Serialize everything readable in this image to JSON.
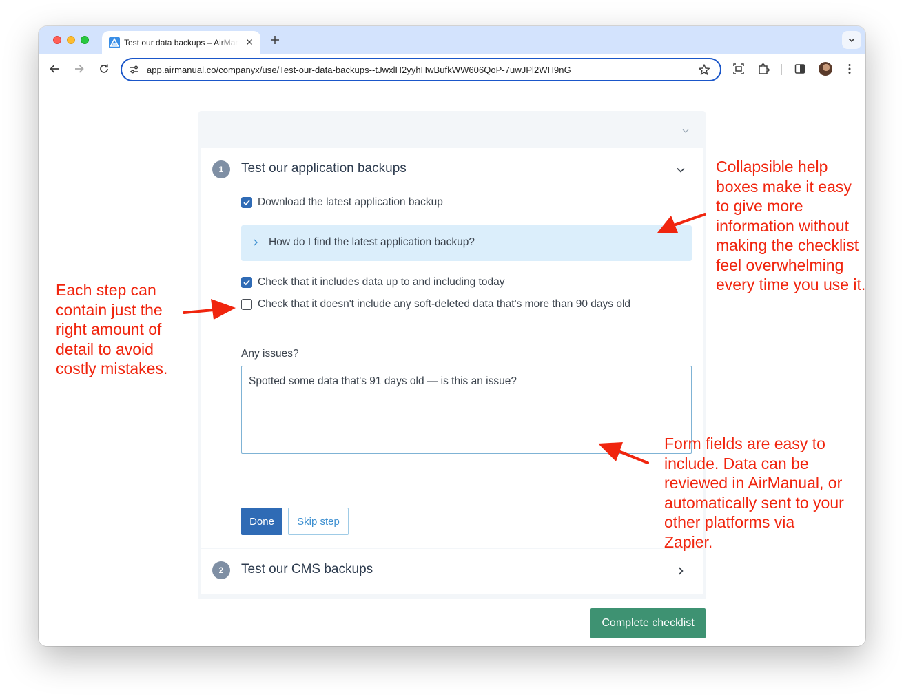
{
  "browser": {
    "tab_title": "Test our data backups – AirManual",
    "url": "app.airmanual.co/companyx/use/Test-our-data-backups--tJwxlH2yyhHwBufkWW606QoP-7uwJPl2WH9nG"
  },
  "checklist": {
    "step1": {
      "number": "1",
      "title": "Test our application backups",
      "items": [
        {
          "label": "Download the latest application backup",
          "checked": true
        },
        {
          "label": "Check that it includes data up to and including today",
          "checked": true
        },
        {
          "label": "Check that it doesn't include any soft-deleted data that's more than 90 days old",
          "checked": false
        }
      ],
      "help_box": "How do I find the latest application backup?",
      "field_label": "Any issues?",
      "field_value": "Spotted some data that's 91 days old — is this an issue?",
      "done_label": "Done",
      "skip_label": "Skip step"
    },
    "step2": {
      "number": "2",
      "title": "Test our CMS backups"
    },
    "complete_label": "Complete checklist"
  },
  "annotations": {
    "collapsible": [
      "Collapsible help",
      "boxes make it easy",
      "to give more",
      "information without",
      "making the checklist",
      "feel overwhelming",
      "every time you use it."
    ],
    "step_detail": [
      "Each step can",
      "contain just the",
      "right amount of",
      "detail to avoid",
      "costly mistakes."
    ],
    "form_fields": [
      "Form fields are easy to",
      "include. Data can be",
      "reviewed in AirManual, or",
      "automatically sent to your",
      "other platforms via",
      "Zapier."
    ]
  },
  "colors": {
    "accent_blue": "#2f6bb5",
    "success_green": "#3e9272",
    "annotation_red": "#f0250e"
  }
}
